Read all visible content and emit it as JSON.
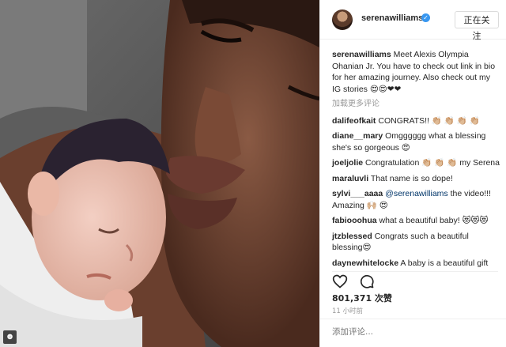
{
  "header": {
    "username": "serenawilliams",
    "follow_label": "正在关注"
  },
  "caption": {
    "username": "serenawilliams",
    "text": "Meet Alexis Olympia Ohanian Jr. You have to check out link in bio for her amazing journey. Also check out my IG stories 😍😍❤❤"
  },
  "load_more": "加载更多评论",
  "comments": [
    {
      "user": "dalifeofkait",
      "text": "CONGRATS!! 👏🏼 👏🏼 👏🏼 👏🏼"
    },
    {
      "user": "diane__mary",
      "text": "Omgggggg what a blessing she's so gorgeous 😍"
    },
    {
      "user": "joeljolie",
      "text": "Congratulation 👏🏼 👏🏼 👏🏼 my Serena"
    },
    {
      "user": "maraluvli",
      "text": "That name is so dope!"
    },
    {
      "user": "sylvi___aaaa",
      "mention": "@serenawilliams",
      "text": "the video!!! Amazing 🙌🏼 😍"
    },
    {
      "user": "fabiooohua",
      "text": "what a beautiful baby! 😻😻😻"
    },
    {
      "user": "jtzblessed",
      "text": "Congrats such a beautiful blessing😍"
    },
    {
      "user": "daynewhitelocke",
      "text": "A baby is a beautiful gift"
    }
  ],
  "likes": "801,371 次赞",
  "time": "11 小时前",
  "add_comment_placeholder": "添加评论...",
  "icons": {
    "verified": "verified-badge-icon",
    "like": "heart-icon",
    "comment": "comment-icon",
    "watermark": "user-silhouette-icon"
  },
  "colors": {
    "verified": "#3897f0",
    "border": "#efefef",
    "muted": "#999999",
    "mention": "#003569"
  }
}
